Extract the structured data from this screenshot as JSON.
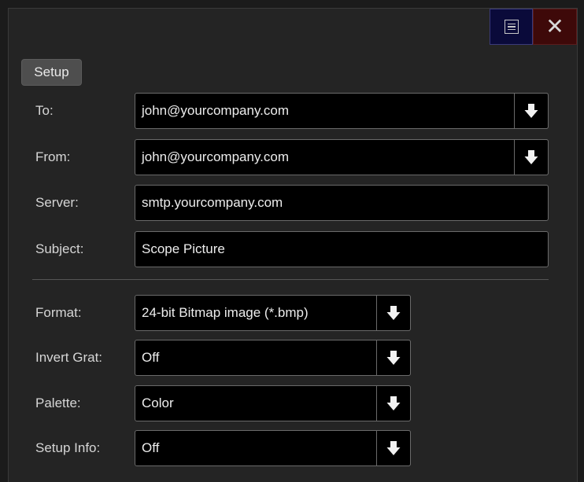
{
  "titlebar": {
    "menu_icon": "menu-icon",
    "close_icon": "close-icon",
    "close_glyph": "✕"
  },
  "tab": {
    "label": "Setup"
  },
  "fields": {
    "to": {
      "label": "To:",
      "value": "john@yourcompany.com"
    },
    "from": {
      "label": "From:",
      "value": "john@yourcompany.com"
    },
    "server": {
      "label": "Server:",
      "value": "smtp.yourcompany.com"
    },
    "subject": {
      "label": "Subject:",
      "value": "Scope Picture"
    },
    "format": {
      "label": "Format:",
      "value": "24-bit Bitmap image (*.bmp)"
    },
    "invert_grat": {
      "label": "Invert Grat:",
      "value": "Off"
    },
    "palette": {
      "label": "Palette:",
      "value": "Color"
    },
    "setup_info": {
      "label": "Setup Info:",
      "value": "Off"
    }
  },
  "colors": {
    "panel": "#242424",
    "field": "#000000",
    "close_bg": "#3e0909",
    "menu_bg": "#0a0a3a",
    "tab": "#4e4e4e"
  }
}
